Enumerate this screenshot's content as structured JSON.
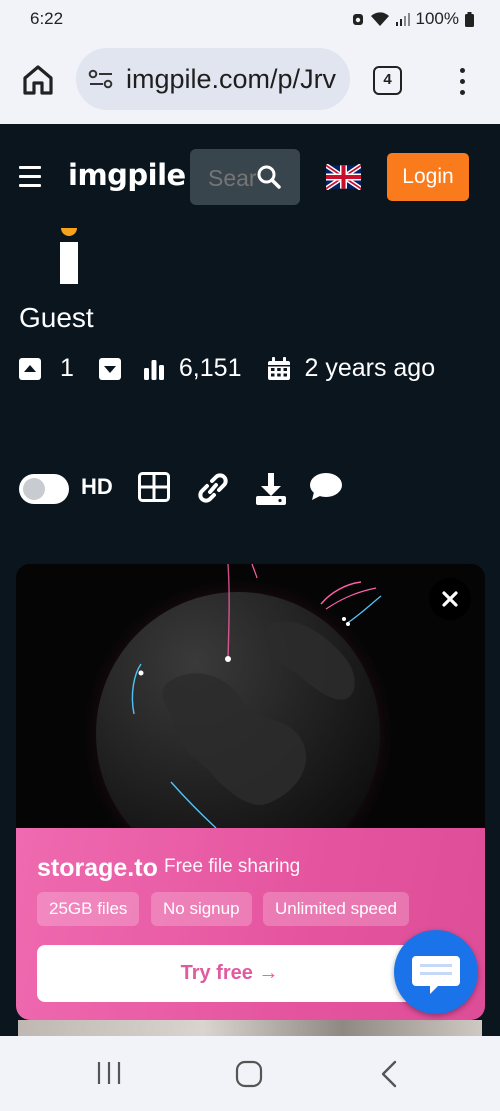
{
  "status_bar": {
    "time": "6:22",
    "battery": "100%"
  },
  "browser": {
    "url": "imgpile.com/p/Jrv",
    "tab_count": "4"
  },
  "site": {
    "logo": "imgpile",
    "search_placeholder": "Search",
    "login_label": "Login",
    "language_flag": "uk-flag-icon"
  },
  "post": {
    "username": "Guest",
    "upvotes": "1",
    "views": "6,151",
    "posted": "2 years ago"
  },
  "toolbar": {
    "hd_label": "HD",
    "hd_enabled": false
  },
  "ad": {
    "brand": "storage.to",
    "tagline": "Free file sharing",
    "chips": [
      "25GB files",
      "No signup",
      "Unlimited speed"
    ],
    "cta": "Try free →"
  },
  "colors": {
    "site_bg": "#0a151d",
    "login": "#fa7b1c",
    "ad_pink": "#e5559f",
    "chat_fab": "#1a73e8"
  }
}
